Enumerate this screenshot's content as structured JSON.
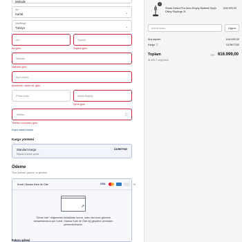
{
  "address": {
    "top_clip": "Mahalle",
    "city": {
      "label": "İlçe",
      "value": "Kartal"
    },
    "country": {
      "label": "Ülke/Bölge",
      "value": "Türkiye"
    },
    "first_name": {
      "placeholder": "Ad",
      "error": "Ad girin"
    },
    "last_name": {
      "placeholder": "Soyadı",
      "error": "Soyadı girin"
    },
    "district": {
      "placeholder": "Mahalle",
      "error": "Mahalle girin"
    },
    "street": {
      "placeholder": "Açık Adres",
      "error": "Apartman, daire vb. girin"
    },
    "postal": {
      "placeholder": "Posta kodu"
    },
    "province": {
      "placeholder": "Adres Başlığı",
      "error": "Şehir girin"
    },
    "phone": {
      "placeholder": "Telefon",
      "error": "Telefon numarası girin"
    },
    "save_link": "Kaydı adres kullan"
  },
  "shipping": {
    "title": "Kargo yöntemi",
    "option_name": "Standart Kargo",
    "option_desc": "Sipariş üzerine yapılır",
    "option_price": "ÜCRETSİZ"
  },
  "payment": {
    "title": "Ödeme",
    "subtitle": "Tüm işlemler güvenli ve şifrelidir.",
    "method": "Kredi / Banka Kartı ile Öde",
    "cards": [
      "VISA",
      "mastercard",
      "amex",
      "discover"
    ],
    "more_cards": "+4",
    "redirect_text": "\"Şimdi öde\" düğmesine tıkladıktan sonra, satın alımınızı güvenle tamamlamanız için Kredi / Banka Kartı ile Öde eğ geçidine yemeden yönlendirilirsiniz.",
    "billing_title": "Fatura adresi"
  },
  "summary": {
    "qty": "1",
    "product_name": "Shark Detect Pro Auto-Empty Sistemli Şarjlı Dikey Süpürge 2L",
    "product_price": "616.999,00",
    "discount_placeholder": "İndirim kodu",
    "apply_label": "Uygula",
    "subtotal_label": "Ara toplam",
    "subtotal_value": "616.999,00",
    "shipping_label": "Kargo ⓘ",
    "shipping_value": "ÜCRETSİZ",
    "total_label": "Toplam",
    "currency": "TRY",
    "total_value": "616.999,00",
    "tax_note": "82.833,7 vergi dahil"
  },
  "colors": {
    "error": "#c8243a",
    "accent": "#2f4a8c",
    "selected_bg": "#f2f4fb"
  }
}
